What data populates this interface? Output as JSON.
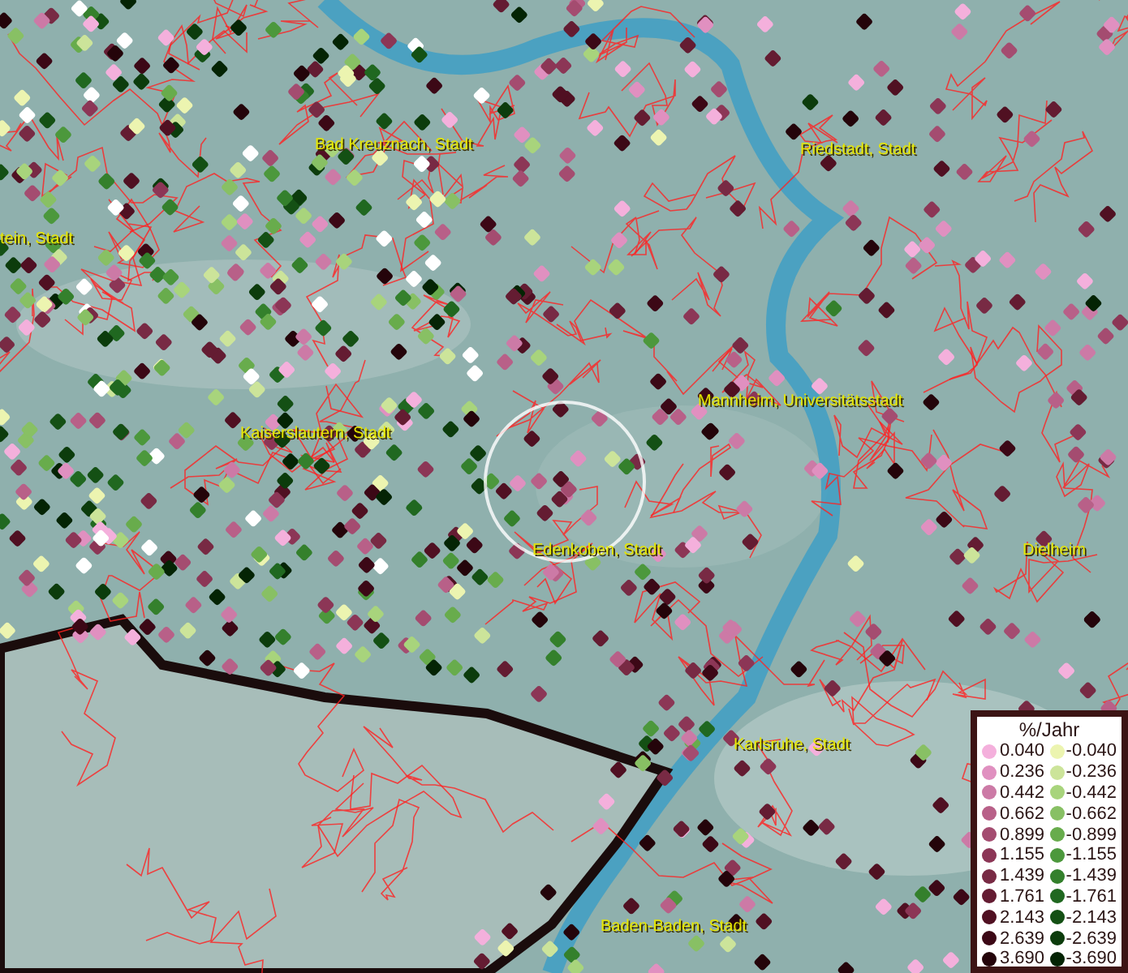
{
  "map": {
    "places": [
      {
        "label": "Bad Kreuznach, Stadt"
      },
      {
        "label": "Riedstadt, Stadt"
      },
      {
        "label": "tein, Stadt"
      },
      {
        "label": "Kaiserslautern, Stadt"
      },
      {
        "label": "Mannheim, Universitätsstadt"
      },
      {
        "label": "Edenkoben, Stadt"
      },
      {
        "label": "Dielheim"
      },
      {
        "label": "Karlsruhe, Stadt"
      },
      {
        "label": "Baden-Baden, Stadt"
      }
    ]
  },
  "legend": {
    "title": "%/Jahr",
    "rows": [
      {
        "up": {
          "value": "0.040",
          "color": "#f4b0dc"
        },
        "down": {
          "value": "-0.040",
          "color": "#ecf4b0"
        }
      },
      {
        "up": {
          "value": "0.236",
          "color": "#e090c0"
        },
        "down": {
          "value": "-0.236",
          "color": "#cce49a"
        }
      },
      {
        "up": {
          "value": "0.442",
          "color": "#cc7aa6"
        },
        "down": {
          "value": "-0.442",
          "color": "#a8d47c"
        }
      },
      {
        "up": {
          "value": "0.662",
          "color": "#b86088"
        },
        "down": {
          "value": "-0.662",
          "color": "#88c064"
        }
      },
      {
        "up": {
          "value": "0.899",
          "color": "#a44c70"
        },
        "down": {
          "value": "-0.899",
          "color": "#68ac4c"
        }
      },
      {
        "up": {
          "value": "1.155",
          "color": "#8c3656"
        },
        "down": {
          "value": "-1.155",
          "color": "#4c983c"
        }
      },
      {
        "up": {
          "value": "1.439",
          "color": "#782a44"
        },
        "down": {
          "value": "-1.439",
          "color": "#34802c"
        }
      },
      {
        "up": {
          "value": "1.761",
          "color": "#641c32"
        },
        "down": {
          "value": "-1.761",
          "color": "#206820"
        }
      },
      {
        "up": {
          "value": "2.143",
          "color": "#501022"
        },
        "down": {
          "value": "-2.143",
          "color": "#145014"
        }
      },
      {
        "up": {
          "value": "2.639",
          "color": "#3c0816"
        },
        "down": {
          "value": "-2.639",
          "color": "#0c3c0c"
        }
      },
      {
        "up": {
          "value": "3.690",
          "color": "#24040a"
        },
        "down": {
          "value": "-3.690",
          "color": "#042404"
        }
      }
    ]
  }
}
